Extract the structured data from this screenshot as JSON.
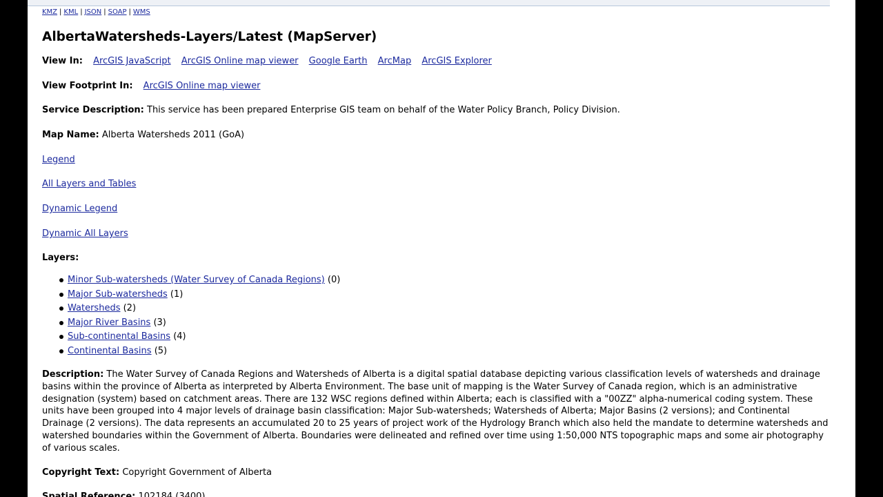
{
  "formats": [
    "KMZ",
    "KML",
    "JSON",
    "SOAP",
    "WMS"
  ],
  "title": "AlbertaWatersheds-Layers/Latest (MapServer)",
  "view_in": {
    "label": "View In:",
    "links": [
      "ArcGIS JavaScript",
      "ArcGIS Online map viewer",
      "Google Earth",
      "ArcMap",
      "ArcGIS Explorer"
    ]
  },
  "view_footprint": {
    "label": "View Footprint In:",
    "link": "ArcGIS Online map viewer"
  },
  "service_description": {
    "label": "Service Description:",
    "text": "This service has been prepared Enterprise GIS team on behalf of the Water Policy Branch, Policy Division."
  },
  "map_name": {
    "label": "Map Name:",
    "text": "Alberta Watersheds 2011 (GoA)"
  },
  "nav_links": {
    "legend": "Legend",
    "all_layers": "All Layers and Tables",
    "dynamic_legend": "Dynamic Legend",
    "dynamic_all_layers": "Dynamic All Layers"
  },
  "layers": {
    "label": "Layers:",
    "items": [
      {
        "name": "Minor Sub-watersheds (Water Survey of Canada Regions)",
        "id": "(0)"
      },
      {
        "name": "Major Sub-watersheds",
        "id": "(1)"
      },
      {
        "name": "Watersheds",
        "id": "(2)"
      },
      {
        "name": "Major River Basins",
        "id": "(3)"
      },
      {
        "name": "Sub-continental Basins",
        "id": "(4)"
      },
      {
        "name": "Continental Basins",
        "id": "(5)"
      }
    ]
  },
  "description": {
    "label": "Description:",
    "text": "The Water Survey of Canada Regions and Watersheds of Alberta is a digital spatial database depicting various classification levels of watersheds and drainage basins within the province of Alberta as interpreted by Alberta Environment. The base unit of mapping is the Water Survey of Canada region, which is an administrative designation (system) based on catchment areas. There are 132 WSC regions defined within Alberta; each is classified with a \"00ZZ\" alpha-numerical coding system. These units have been grouped into 4 major levels of drainage basin classification: Major Sub-watersheds; Watersheds of Alberta; Major Basins (2 versions); and Continental Drainage (2 versions). The data represents an accumulated 20 to 25 years of project work of the Hydrology Branch which also held the mandate to determine watersheds and watershed boundaries within the Government of Alberta. Boundaries were delineated and refined over time using 1:50,000 NTS topographic maps and some air photography of various scales."
  },
  "copyright": {
    "label": "Copyright Text:",
    "text": "Copyright Government of Alberta"
  },
  "spatial_reference": {
    "label": "Spatial Reference:",
    "text": "102184  (3400)"
  },
  "colors": {
    "link": "#1c2a9e",
    "page_bg": "#ffffff",
    "outer_bg": "#000000"
  }
}
